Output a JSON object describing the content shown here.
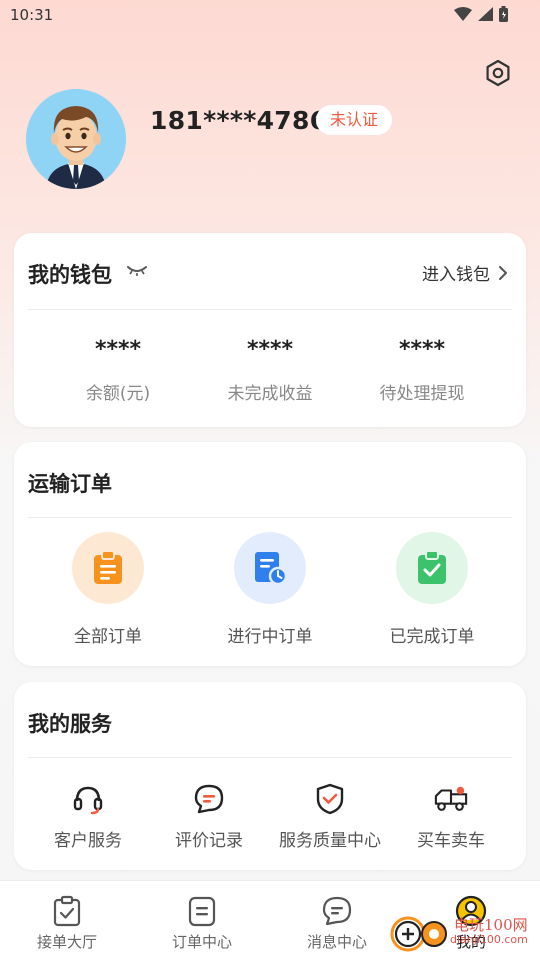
{
  "status_bar": {
    "time": "10:31"
  },
  "profile": {
    "phone": "181****4786",
    "verify_status": "未认证"
  },
  "wallet": {
    "title": "我的钱包",
    "link": "进入钱包",
    "stats": [
      {
        "value": "****",
        "label": "余额(元)"
      },
      {
        "value": "****",
        "label": "未完成收益"
      },
      {
        "value": "****",
        "label": "待处理提现"
      }
    ]
  },
  "orders": {
    "title": "运输订单",
    "items": [
      {
        "label": "全部订单",
        "icon": "clipboard-icon",
        "bg": "#fde9d3",
        "color": "#f7921e"
      },
      {
        "label": "进行中订单",
        "icon": "document-clock-icon",
        "bg": "#e3ecfd",
        "color": "#2f80ed"
      },
      {
        "label": "已完成订单",
        "icon": "clipboard-check-icon",
        "bg": "#e1f6e6",
        "color": "#3cc26a"
      }
    ]
  },
  "services": {
    "title": "我的服务",
    "items": [
      {
        "label": "客户服务",
        "icon": "headset-icon"
      },
      {
        "label": "评价记录",
        "icon": "chat-bubble-icon"
      },
      {
        "label": "服务质量中心",
        "icon": "shield-check-icon"
      },
      {
        "label": "买车卖车",
        "icon": "truck-icon"
      }
    ]
  },
  "tabbar": {
    "items": [
      {
        "label": "接单大厅",
        "icon": "clipboard-check-icon"
      },
      {
        "label": "订单中心",
        "icon": "list-icon"
      },
      {
        "label": "消息中心",
        "icon": "message-icon"
      },
      {
        "label": "我的",
        "icon": "user-icon",
        "active": true
      }
    ]
  },
  "watermark": {
    "text": "电玩100网",
    "sub": "dianji100.com"
  },
  "colors": {
    "accent": "#f05a3e",
    "active_tab": "#f5c400"
  }
}
